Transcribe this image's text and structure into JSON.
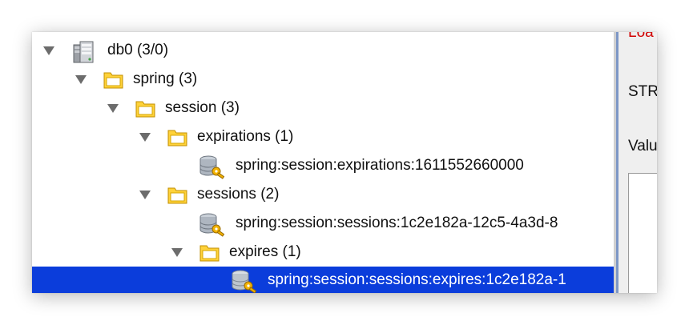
{
  "tree": {
    "nodes": [
      {
        "label": "db0  (3/0)",
        "icon": "database-server-icon"
      },
      {
        "label": "spring (3)",
        "icon": "folder-icon"
      },
      {
        "label": "session (3)",
        "icon": "folder-icon"
      },
      {
        "label": "expirations (1)",
        "icon": "folder-icon"
      },
      {
        "label": "spring:session:expirations:1611552660000",
        "icon": "redis-key-icon"
      },
      {
        "label": "sessions (2)",
        "icon": "folder-icon"
      },
      {
        "label": "spring:session:sessions:1c2e182a-12c5-4a3d-8",
        "icon": "redis-key-icon"
      },
      {
        "label": "expires (1)",
        "icon": "folder-icon"
      },
      {
        "label": "spring:session:sessions:expires:1c2e182a-1",
        "icon": "redis-key-icon",
        "selected": true
      }
    ]
  },
  "right_panel": {
    "top_label": "Loa",
    "type_label": "STR",
    "value_label": "Valu"
  },
  "colors": {
    "selection": "#0b3ddb",
    "folder": "#f5c400",
    "divider": "#7d97c6"
  }
}
